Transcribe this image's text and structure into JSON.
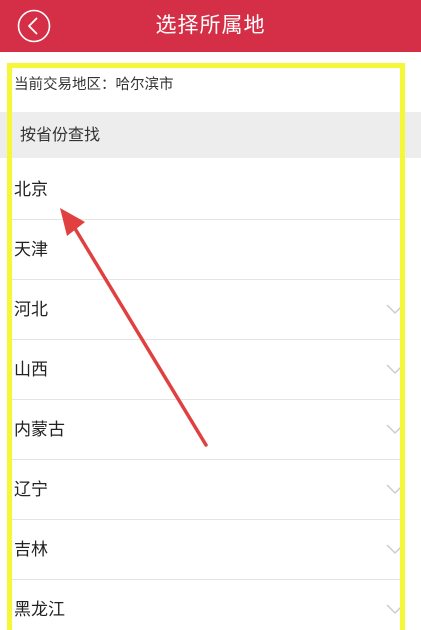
{
  "header": {
    "title": "选择所属地",
    "back_icon": "back-arrow-circle-icon",
    "background_color": "#d52f47"
  },
  "current_region": {
    "text": "当前交易地区：哈尔滨市"
  },
  "section": {
    "label": "按省份查找"
  },
  "provinces": [
    {
      "label": "北京",
      "has_chevron": false
    },
    {
      "label": "天津",
      "has_chevron": false
    },
    {
      "label": "河北",
      "has_chevron": true
    },
    {
      "label": "山西",
      "has_chevron": true
    },
    {
      "label": "内蒙古",
      "has_chevron": true
    },
    {
      "label": "辽宁",
      "has_chevron": true
    },
    {
      "label": "吉林",
      "has_chevron": true
    },
    {
      "label": "黑龙江",
      "has_chevron": true
    }
  ],
  "annotations": {
    "highlight_color": "#f7f73a",
    "arrow_color": "#e0403f",
    "arrow_points_to": "北京"
  }
}
